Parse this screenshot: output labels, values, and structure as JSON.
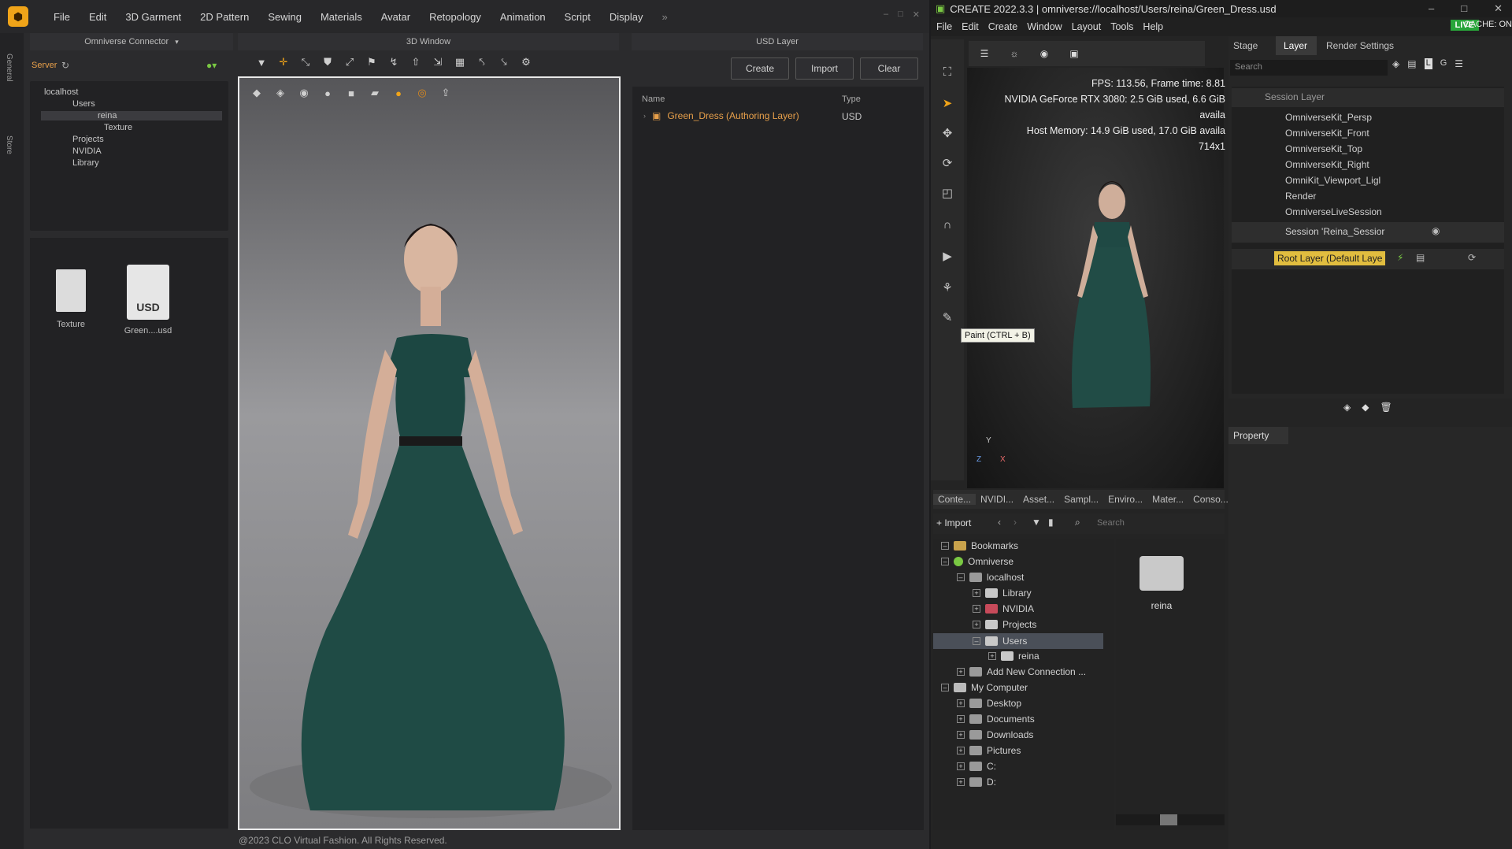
{
  "clo": {
    "menu": [
      "File",
      "Edit",
      "3D Garment",
      "2D Pattern",
      "Sewing",
      "Materials",
      "Avatar",
      "Retopology",
      "Animation",
      "Script",
      "Display"
    ],
    "side_tabs": [
      "General",
      "Store"
    ],
    "connector_title": "Omniverse Connector",
    "server_label": "Server",
    "tree": [
      "localhost",
      "Users",
      "reina",
      "Texture",
      "Projects",
      "NVIDIA",
      "Library"
    ],
    "files": [
      {
        "name": "Texture"
      },
      {
        "name": "Green....usd",
        "badge": "USD"
      }
    ],
    "window3d_title": "3D Window",
    "usd_title": "USD Layer",
    "buttons": {
      "create": "Create",
      "import": "Import",
      "clear": "Clear"
    },
    "usd_cols": {
      "name": "Name",
      "type": "Type"
    },
    "usd_row": {
      "name": "Green_Dress (Authoring Layer)",
      "type": "USD"
    },
    "copyright": "@2023 CLO Virtual Fashion. All Rights Reserved."
  },
  "omni": {
    "title": "CREATE  2022.3.3 | omniverse://localhost/Users/reina/Green_Dress.usd",
    "menu": [
      "File",
      "Edit",
      "Create",
      "Window",
      "Layout",
      "Tools",
      "Help"
    ],
    "live": "LIVE",
    "cache": "CACHE: ON",
    "hud": [
      "FPS: 113.56, Frame time: 8.81",
      "NVIDIA GeForce RTX 3080: 2.5 GiB used, 6.6 GiB availa",
      "Host Memory: 14.9 GiB used, 17.0 GiB availa",
      "714x1"
    ],
    "tooltip": "Paint (CTRL + B)",
    "tabs": [
      "Stage",
      "Layer",
      "Render Settings"
    ],
    "search": "Search",
    "layers": [
      "Session Layer",
      "OmniverseKit_Persp",
      "OmniverseKit_Front",
      "OmniverseKit_Top",
      "OmniverseKit_Right",
      "OmniKit_Viewport_Ligl",
      "Render",
      "OmniverseLiveSession",
      "Session 'Reina_Sessior",
      "Root Layer (Default Laye"
    ],
    "property": "Property",
    "content_tabs": [
      "Conte...",
      "NVIDI...",
      "Asset...",
      "Sampl...",
      "Enviro...",
      "Mater...",
      "Conso..."
    ],
    "import": "Import",
    "cb_search": "Search",
    "content_tree": [
      "Bookmarks",
      "Omniverse",
      "localhost",
      "Library",
      "NVIDIA",
      "Projects",
      "Users",
      "reina",
      "Add New Connection ...",
      "My Computer",
      "Desktop",
      "Documents",
      "Downloads",
      "Pictures",
      "C:",
      "D:"
    ],
    "folder": "reina",
    "axis": {
      "y": "Y",
      "z": "Z",
      "x": "X"
    }
  }
}
